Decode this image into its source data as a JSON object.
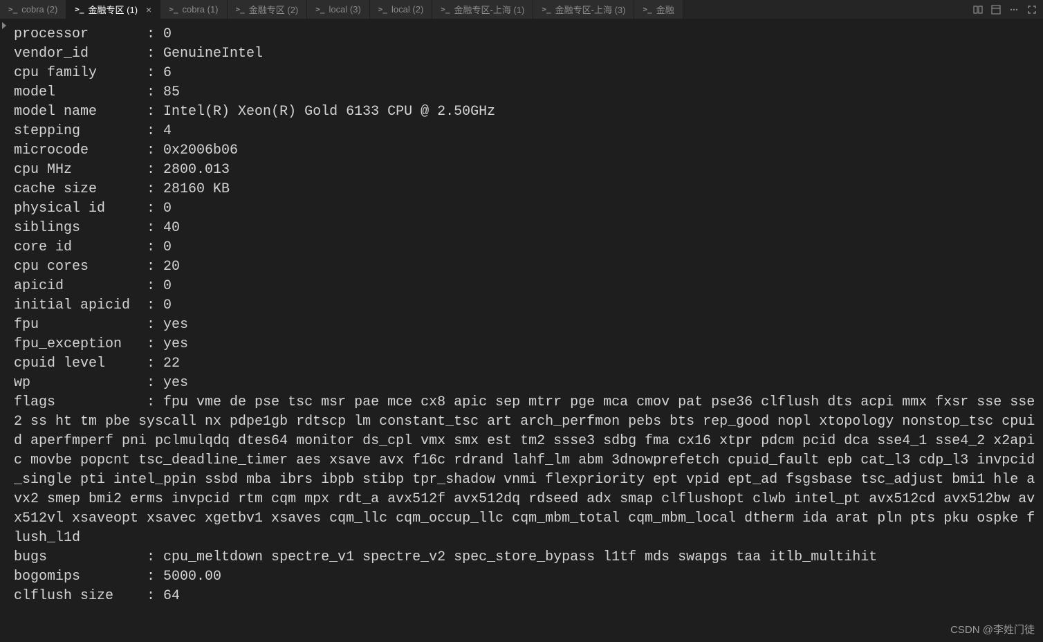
{
  "tabs": [
    {
      "icon": ">_",
      "label": "cobra (2)",
      "active": false
    },
    {
      "icon": ">_",
      "label": "金融专区 (1)",
      "active": true
    },
    {
      "icon": ">_",
      "label": "cobra (1)",
      "active": false
    },
    {
      "icon": ">_",
      "label": "金融专区 (2)",
      "active": false
    },
    {
      "icon": ">_",
      "label": "local (3)",
      "active": false
    },
    {
      "icon": ">_",
      "label": "local (2)",
      "active": false
    },
    {
      "icon": ">_",
      "label": "金融专区-上海 (1)",
      "active": false
    },
    {
      "icon": ">_",
      "label": "金融专区-上海 (3)",
      "active": false
    },
    {
      "icon": ">_",
      "label": "金融",
      "active": false
    }
  ],
  "close_glyph": "×",
  "cpuinfo": {
    "rows": [
      {
        "k": "processor",
        "v": "0"
      },
      {
        "k": "vendor_id",
        "v": "GenuineIntel"
      },
      {
        "k": "cpu family",
        "v": "6"
      },
      {
        "k": "model",
        "v": "85"
      },
      {
        "k": "model name",
        "v": "Intel(R) Xeon(R) Gold 6133 CPU @ 2.50GHz"
      },
      {
        "k": "stepping",
        "v": "4"
      },
      {
        "k": "microcode",
        "v": "0x2006b06"
      },
      {
        "k": "cpu MHz",
        "v": "2800.013"
      },
      {
        "k": "cache size",
        "v": "28160 KB"
      },
      {
        "k": "physical id",
        "v": "0"
      },
      {
        "k": "siblings",
        "v": "40"
      },
      {
        "k": "core id",
        "v": "0"
      },
      {
        "k": "cpu cores",
        "v": "20"
      },
      {
        "k": "apicid",
        "v": "0"
      },
      {
        "k": "initial apicid",
        "v": "0"
      },
      {
        "k": "fpu",
        "v": "yes"
      },
      {
        "k": "fpu_exception",
        "v": "yes"
      },
      {
        "k": "cpuid level",
        "v": "22"
      },
      {
        "k": "wp",
        "v": "yes"
      }
    ],
    "flags_key": "flags",
    "flags_value": "fpu vme de pse tsc msr pae mce cx8 apic sep mtrr pge mca cmov pat pse36 clflush dts acpi mmx fxsr sse sse2 ss ht tm pbe syscall nx pdpe1gb rdtscp lm constant_tsc art arch_perfmon pebs bts rep_good nopl xtopology nonstop_tsc cpuid aperfmperf pni pclmulqdq dtes64 monitor ds_cpl vmx smx est tm2 ssse3 sdbg fma cx16 xtpr pdcm pcid dca sse4_1 sse4_2 x2apic movbe popcnt tsc_deadline_timer aes xsave avx f16c rdrand lahf_lm abm 3dnowprefetch cpuid_fault epb cat_l3 cdp_l3 invpcid_single pti intel_ppin ssbd mba ibrs ibpb stibp tpr_shadow vnmi flexpriority ept vpid ept_ad fsgsbase tsc_adjust bmi1 hle avx2 smep bmi2 erms invpcid rtm cqm mpx rdt_a avx512f avx512dq rdseed adx smap clflushopt clwb intel_pt avx512cd avx512bw avx512vl xsaveopt xsavec xgetbv1 xsaves cqm_llc cqm_occup_llc cqm_mbm_total cqm_mbm_local dtherm ida arat pln pts pku ospke flush_l1d",
    "tail_rows": [
      {
        "k": "bugs",
        "v": "cpu_meltdown spectre_v1 spectre_v2 spec_store_bypass l1tf mds swapgs taa itlb_multihit"
      },
      {
        "k": "bogomips",
        "v": "5000.00"
      },
      {
        "k": "clflush size",
        "v": "64"
      }
    ]
  },
  "watermark": "CSDN @李姓门徒"
}
